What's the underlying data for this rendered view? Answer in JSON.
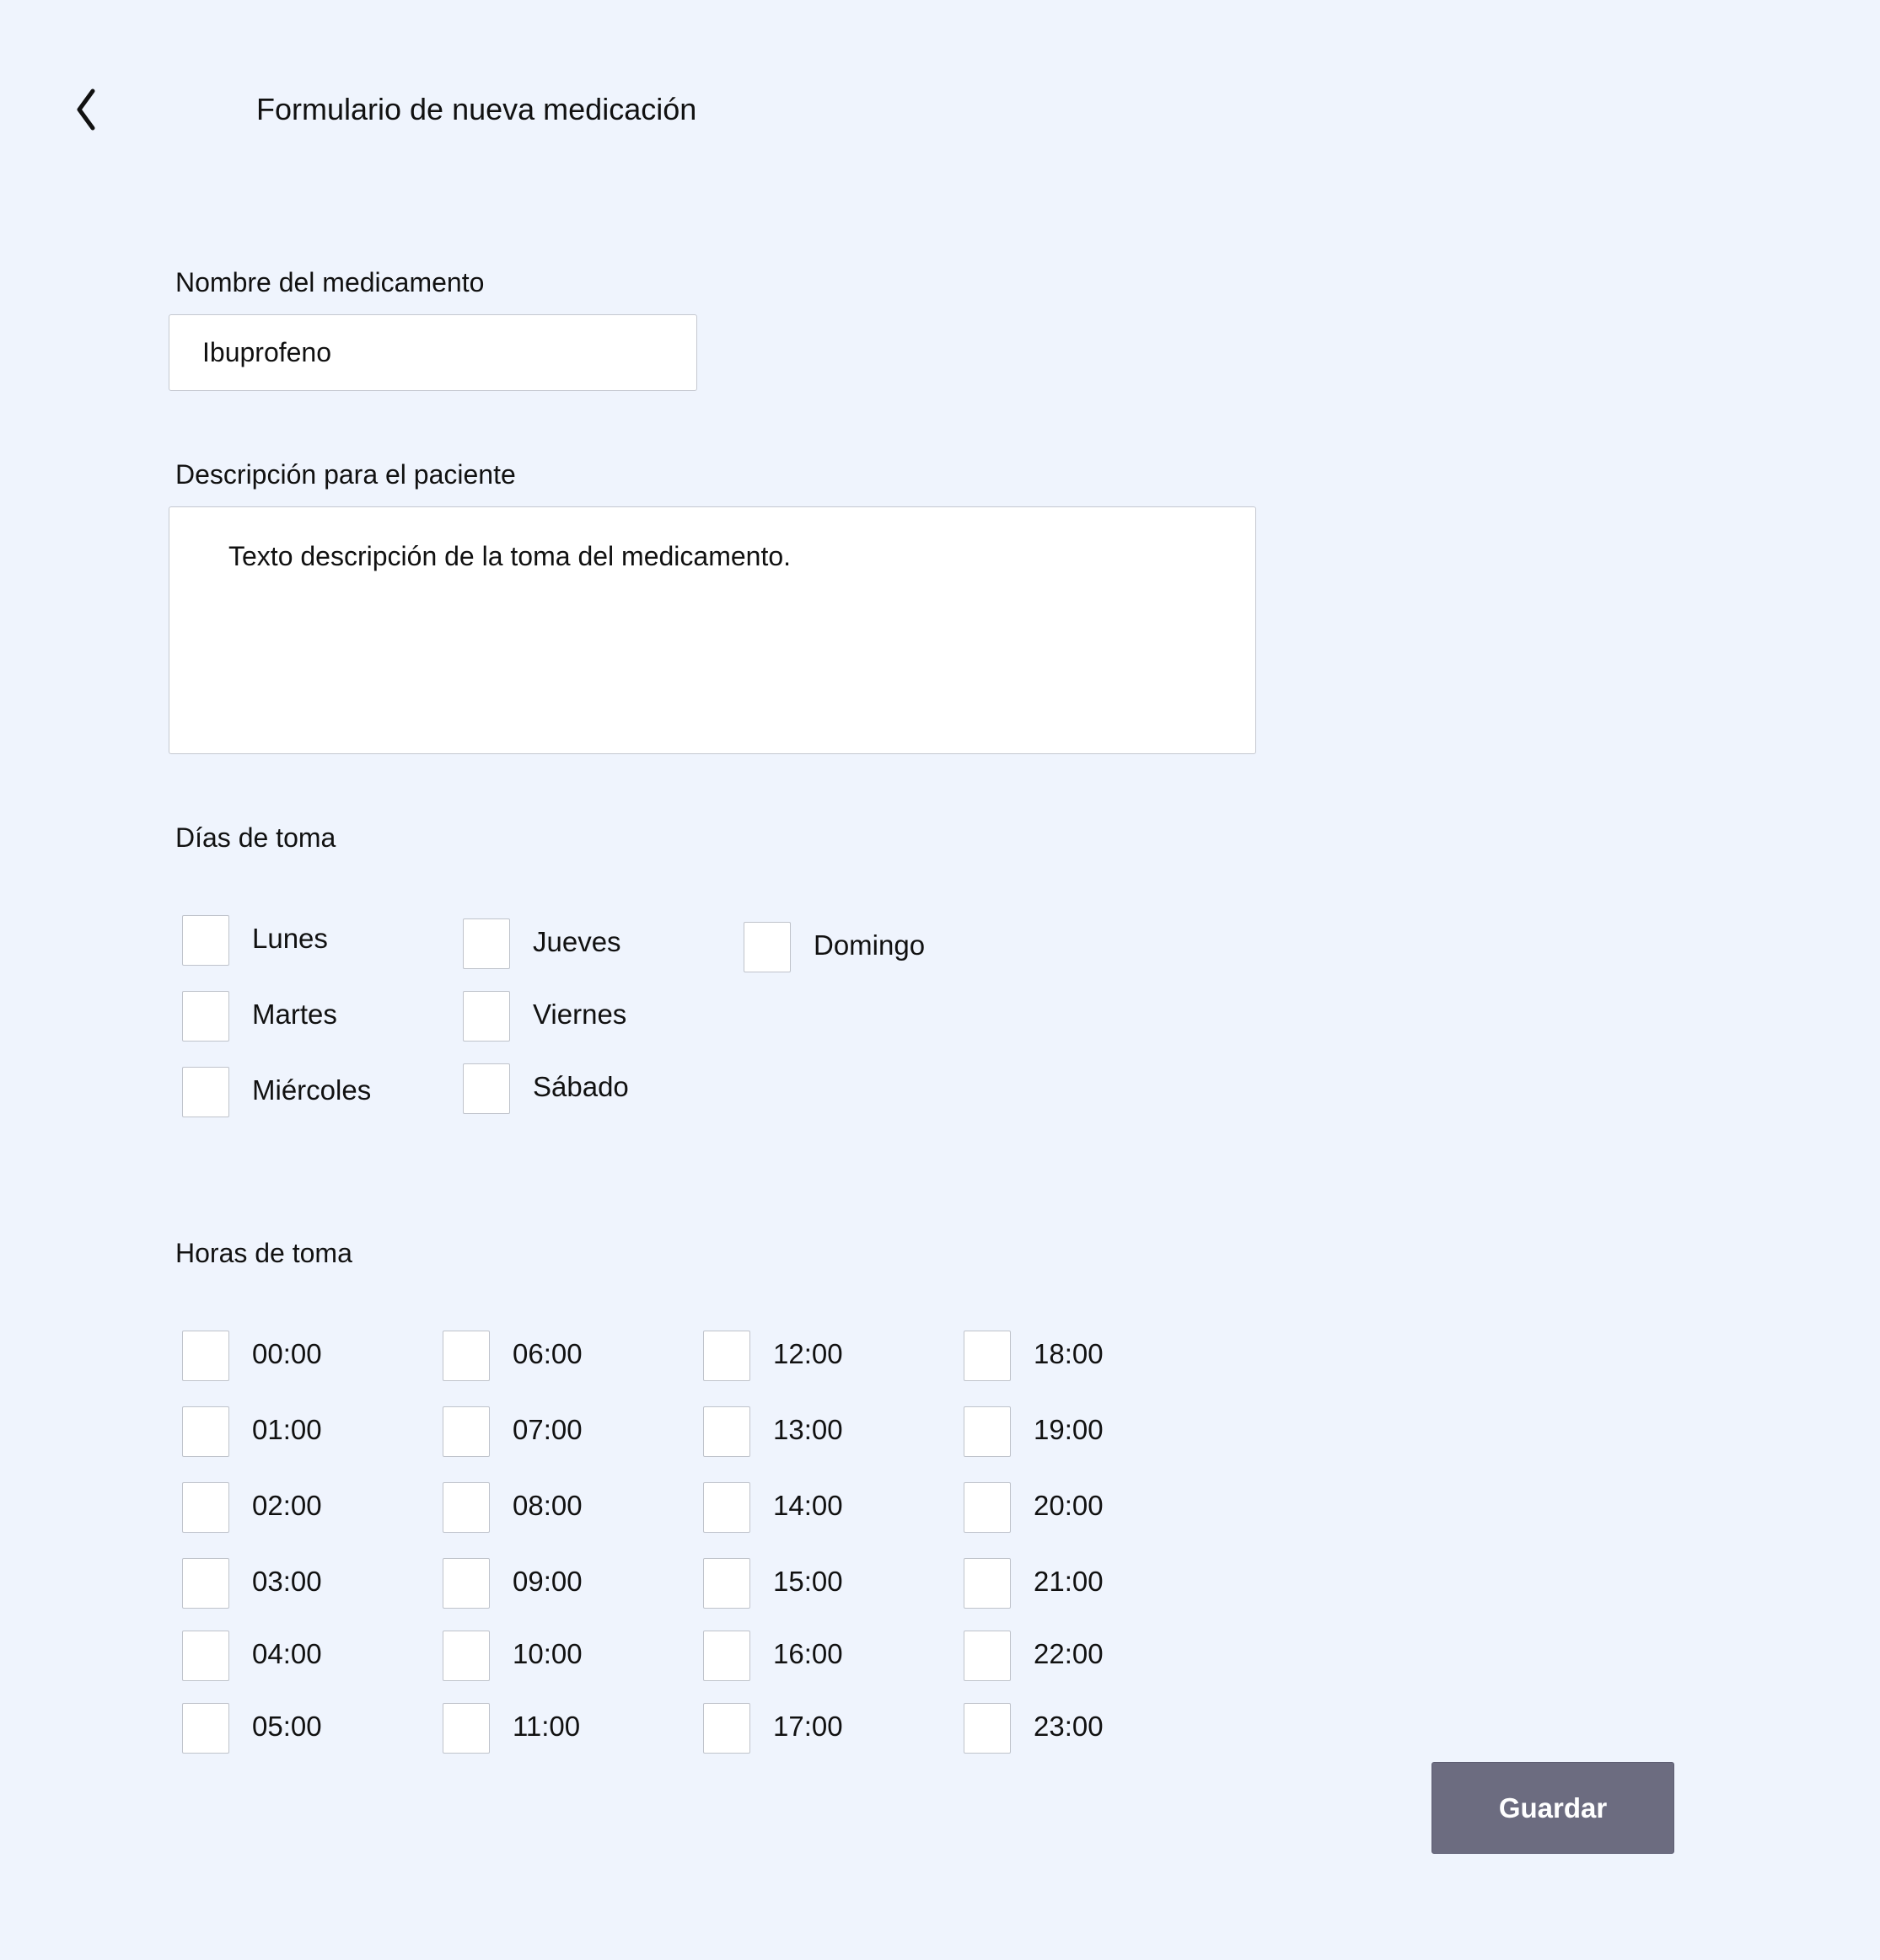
{
  "header": {
    "back_icon": "chevron-left-icon",
    "title": "Formulario de nueva medicación"
  },
  "form": {
    "name": {
      "label": "Nombre del medicamento",
      "value": "Ibuprofeno"
    },
    "description": {
      "label": "Descripción para el paciente",
      "value": "Texto descripción de la toma del medicamento."
    },
    "days": {
      "label": "Días de toma",
      "options": [
        {
          "label": "Lunes",
          "checked": false
        },
        {
          "label": "Martes",
          "checked": false
        },
        {
          "label": "Miércoles",
          "checked": false
        },
        {
          "label": "Jueves",
          "checked": false
        },
        {
          "label": "Viernes",
          "checked": false
        },
        {
          "label": "Sábado",
          "checked": false
        },
        {
          "label": "Domingo",
          "checked": false
        }
      ]
    },
    "hours": {
      "label": "Horas de toma",
      "options": [
        {
          "label": "00:00",
          "checked": false
        },
        {
          "label": "01:00",
          "checked": false
        },
        {
          "label": "02:00",
          "checked": false
        },
        {
          "label": "03:00",
          "checked": false
        },
        {
          "label": "04:00",
          "checked": false
        },
        {
          "label": "05:00",
          "checked": false
        },
        {
          "label": "06:00",
          "checked": false
        },
        {
          "label": "07:00",
          "checked": false
        },
        {
          "label": "08:00",
          "checked": false
        },
        {
          "label": "09:00",
          "checked": false
        },
        {
          "label": "10:00",
          "checked": false
        },
        {
          "label": "11:00",
          "checked": false
        },
        {
          "label": "12:00",
          "checked": false
        },
        {
          "label": "13:00",
          "checked": false
        },
        {
          "label": "14:00",
          "checked": false
        },
        {
          "label": "15:00",
          "checked": false
        },
        {
          "label": "16:00",
          "checked": false
        },
        {
          "label": "17:00",
          "checked": false
        },
        {
          "label": "18:00",
          "checked": false
        },
        {
          "label": "19:00",
          "checked": false
        },
        {
          "label": "20:00",
          "checked": false
        },
        {
          "label": "21:00",
          "checked": false
        },
        {
          "label": "22:00",
          "checked": false
        },
        {
          "label": "23:00",
          "checked": false
        }
      ]
    },
    "save_label": "Guardar"
  },
  "colors": {
    "background": "#eff4fd",
    "button": "#6c6c80",
    "input_border": "#c4c8d0"
  }
}
